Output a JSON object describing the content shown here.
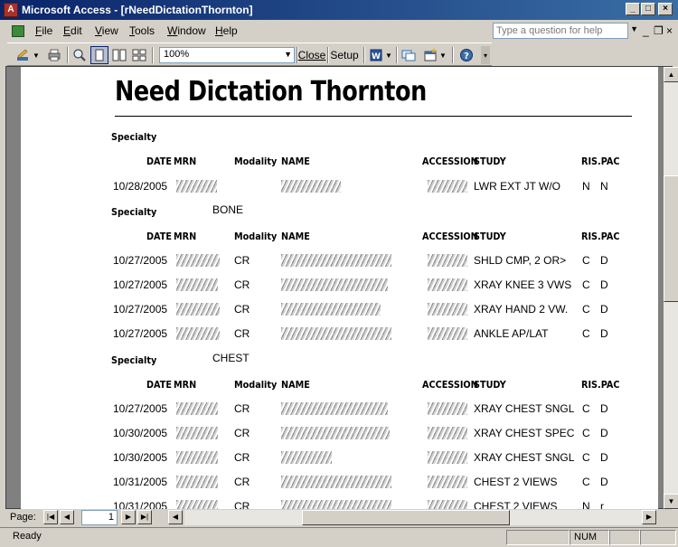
{
  "window": {
    "title": "Microsoft Access - [rNeedDictationThornton]"
  },
  "menu": {
    "items": [
      {
        "label": "File",
        "u": "F",
        "rest": "ile"
      },
      {
        "label": "Edit",
        "u": "E",
        "rest": "dit"
      },
      {
        "label": "View",
        "u": "V",
        "rest": "iew"
      },
      {
        "label": "Tools",
        "u": "T",
        "rest": "ools"
      },
      {
        "label": "Window",
        "u": "W",
        "rest": "indow"
      },
      {
        "label": "Help",
        "u": "H",
        "rest": "elp"
      }
    ],
    "help_placeholder": "Type a question for help"
  },
  "toolbar": {
    "zoom": "100%",
    "close_label": "Close",
    "setup_label": "Setup"
  },
  "report": {
    "title": "Need Dictation Thornton",
    "columns": {
      "date": "DATE",
      "mrn": "MRN",
      "modality": "Modality",
      "name": "NAME",
      "accession": "ACCESSION",
      "study": "STUDY",
      "ris_pac": "RIS.PAC"
    },
    "specialty_label": "Specialty",
    "groups": [
      {
        "specialty": "",
        "rows": [
          {
            "date": "10/28/2005",
            "modality": "",
            "study": "LWR EXT JT W/O",
            "ris": "N",
            "pac": "N"
          }
        ]
      },
      {
        "specialty": "BONE",
        "rows": [
          {
            "date": "10/27/2005",
            "modality": "CR",
            "study": "SHLD CMP, 2 OR>",
            "ris": "C",
            "pac": "D"
          },
          {
            "date": "10/27/2005",
            "modality": "CR",
            "study": "XRAY KNEE 3 VWS",
            "ris": "C",
            "pac": "D"
          },
          {
            "date": "10/27/2005",
            "modality": "CR",
            "study": "XRAY HAND 2 VW.",
            "ris": "C",
            "pac": "D"
          },
          {
            "date": "10/27/2005",
            "modality": "CR",
            "study": "ANKLE AP/LAT",
            "ris": "C",
            "pac": "D"
          }
        ]
      },
      {
        "specialty": "CHEST",
        "rows": [
          {
            "date": "10/27/2005",
            "modality": "CR",
            "study": "XRAY CHEST SNGL",
            "ris": "C",
            "pac": "D"
          },
          {
            "date": "10/30/2005",
            "modality": "CR",
            "study": "XRAY CHEST SPEC",
            "ris": "C",
            "pac": "D"
          },
          {
            "date": "10/30/2005",
            "modality": "CR",
            "study": "XRAY CHEST SNGL",
            "ris": "C",
            "pac": "D"
          },
          {
            "date": "10/31/2005",
            "modality": "CR",
            "study": "CHEST 2 VIEWS",
            "ris": "C",
            "pac": "D"
          },
          {
            "date": "10/31/2005",
            "modality": "CR",
            "study": "CHEST 2 VIEWS",
            "ris": "N",
            "pac": "r"
          }
        ]
      }
    ]
  },
  "nav": {
    "page_label": "Page:",
    "page_number": "1"
  },
  "status": {
    "ready": "Ready",
    "num": "NUM"
  }
}
